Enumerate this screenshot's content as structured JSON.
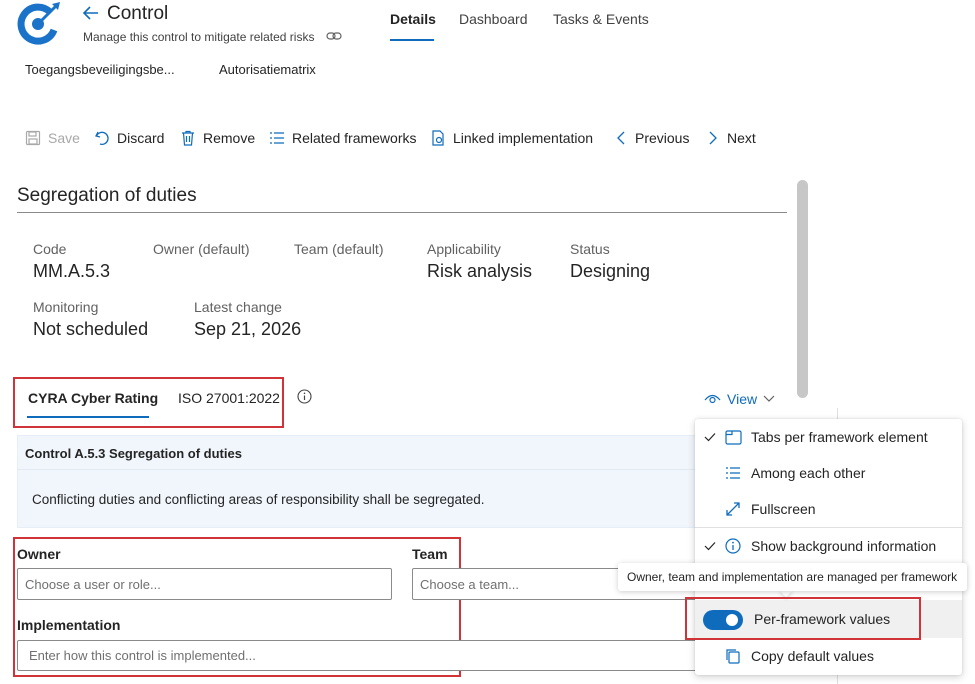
{
  "header": {
    "title": "Control",
    "subtitle": "Manage this control to mitigate related risks",
    "tabs": [
      {
        "label": "Details",
        "active": true
      },
      {
        "label": "Dashboard"
      },
      {
        "label": "Tasks & Events"
      }
    ],
    "breadcrumbs": [
      "Toegangsbeveiligingsbe...",
      "Autorisatiematrix"
    ]
  },
  "toolbar": {
    "save": "Save",
    "discard": "Discard",
    "remove": "Remove",
    "related_frameworks": "Related frameworks",
    "linked_implementation": "Linked implementation",
    "previous": "Previous",
    "next": "Next"
  },
  "section": {
    "title": "Segregation of duties",
    "fields": {
      "code_label": "Code",
      "code_value": "MM.A.5.3",
      "owner_label": "Owner (default)",
      "team_label": "Team (default)",
      "applicability_label": "Applicability",
      "applicability_value": "Risk analysis",
      "status_label": "Status",
      "status_value": "Designing",
      "monitoring_label": "Monitoring",
      "monitoring_value": "Not scheduled",
      "latest_change_label": "Latest change",
      "latest_change_value": "Sep 21, 2026"
    }
  },
  "framework_tabs": [
    {
      "label": "CYRA Cyber Rating",
      "active": true
    },
    {
      "label": "ISO 27001:2022"
    }
  ],
  "view_button": "View",
  "control_card": {
    "title": "Control A.5.3 Segregation of duties",
    "description": "Conflicting duties and conflicting areas of responsibility shall be segregated."
  },
  "form": {
    "owner_label": "Owner",
    "owner_placeholder": "Choose a user or role...",
    "team_label": "Team",
    "team_placeholder": "Choose a team...",
    "implementation_label": "Implementation",
    "implementation_placeholder": "Enter how this control is implemented..."
  },
  "view_menu": {
    "items": [
      {
        "label": "Tabs per framework element",
        "checked": true,
        "icon": "tabs-icon"
      },
      {
        "label": "Among each other",
        "checked": false,
        "icon": "list-icon"
      },
      {
        "label": "Fullscreen",
        "checked": false,
        "icon": "expand-icon"
      },
      {
        "label": "Show background information",
        "checked": true,
        "icon": "info-icon"
      }
    ],
    "toggle_label": "Per-framework values",
    "toggle_on": true,
    "copy_label": "Copy default values"
  },
  "tooltip": "Owner, team and implementation are managed per framework",
  "colors": {
    "accent": "#0f6cbd",
    "highlight_border": "#d13438"
  }
}
